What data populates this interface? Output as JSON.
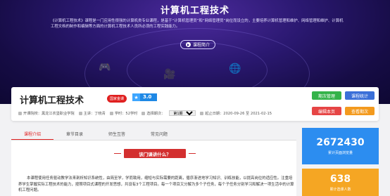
{
  "hero": {
    "title": "计算机工程技术",
    "description": "《计算机工程技术》课程是一门应用性很强的计算机类专业课程，是基于“计算机管理员”和“网络管理员”岗位而设立的，主要培养计算机管理和维护、网络管理和维护、计算机工程文档的制作和编辑等方面的计算机工程技术人员所必须的工程实践能力。",
    "intro_button": "课程简介"
  },
  "course": {
    "name": "计算机工程技术",
    "badge": "国家金课",
    "score": "3.0",
    "meta": {
      "college_prefix": "开课院校：",
      "college": "黑龙江农垦职业学院",
      "lecturer_prefix": "主讲：",
      "lecturer": "丁晓青",
      "hours_prefix": "学时：",
      "hours": "52学时",
      "term_prefix": "选择期次：",
      "term_selected": "第1期",
      "dates": "起止日期：2020-09-26 至 2021-02-15"
    },
    "actions": {
      "term_manage": "期次管理",
      "course_stats": "课程统计",
      "edit_page": "编辑本页",
      "view_term": "查看期次"
    }
  },
  "tabs": [
    "课程介绍",
    "章节目录",
    "师生互答",
    "常见问题"
  ],
  "intro": {
    "section_title": "该门课讲什么？",
    "paragraph": "本课程使用任务驱动教学法来剖析知识系统性，由简至学，学而致用，缩短与实际需要的距离，循序渐进地学习知识、训练技能，以提高岗位的适应性。注重培养学生掌握实际工程技术的能力，按照项目式课程的开发思想，共设有3个工程项目。每一个项目又分解为多个子任务，每个子任务分别学习和解决一项生活中的计算机工程问题。"
  },
  "stats": [
    {
      "value": "2672430",
      "label": "累计页面浏览量"
    },
    {
      "value": "638",
      "label": "累计选课人数"
    }
  ],
  "colors": {
    "accent_red": "#e02020",
    "btn_green": "#34b34a",
    "btn_blue": "#3a6fd8",
    "btn_red": "#e64545",
    "btn_orange": "#f39a1e",
    "stat_blue": "#2c8df0",
    "stat_orange": "#f5a623"
  }
}
